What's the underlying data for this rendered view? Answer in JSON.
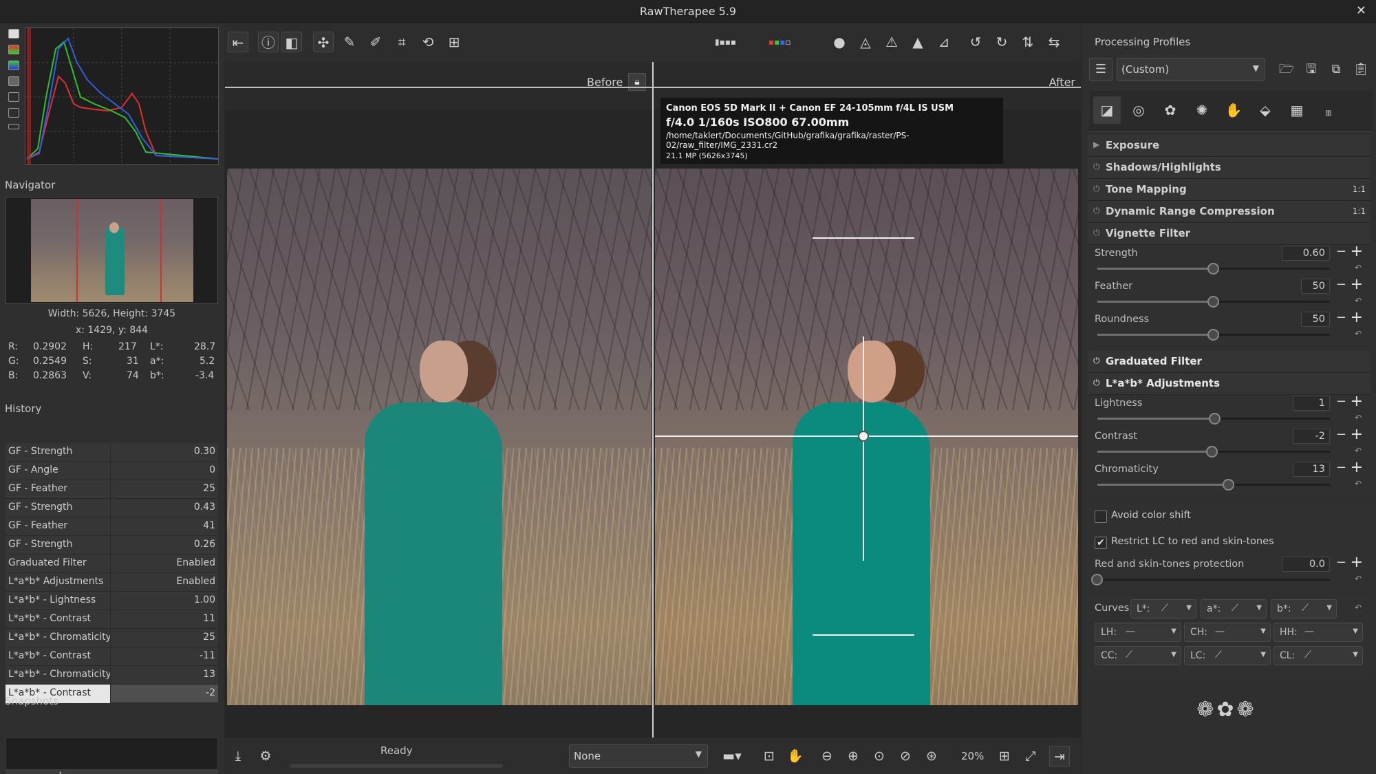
{
  "window": {
    "title": "RawTherapee 5.9"
  },
  "left": {
    "navigator_label": "Navigator",
    "size_text": "Width: 5626, Height: 3745",
    "coords_text": "x: 1429, y: 844",
    "readout": {
      "r_label": "R:",
      "r_val": "0.2902",
      "h_label": "H:",
      "h_val": "217",
      "l_label": "L*:",
      "l_val": "28.7",
      "g_label": "G:",
      "g_val": "0.2549",
      "s_label": "S:",
      "s_val": "31",
      "a_label": "a*:",
      "a_val": "5.2",
      "b_label": "B:",
      "b_val": "0.2863",
      "v_label": "V:",
      "v_val": "74",
      "bs_label": "b*:",
      "bs_val": "-3.4"
    },
    "history_label": "History",
    "history": [
      {
        "name": "GF - Strength",
        "value": "0.30"
      },
      {
        "name": "GF - Angle",
        "value": "0"
      },
      {
        "name": "GF - Feather",
        "value": "25"
      },
      {
        "name": "GF - Strength",
        "value": "0.43"
      },
      {
        "name": "GF - Feather",
        "value": "41"
      },
      {
        "name": "GF - Strength",
        "value": "0.26"
      },
      {
        "name": "Graduated Filter",
        "value": "Enabled"
      },
      {
        "name": "L*a*b* Adjustments",
        "value": "Enabled"
      },
      {
        "name": "L*a*b* - Lightness",
        "value": "1.00"
      },
      {
        "name": "L*a*b* - Contrast",
        "value": "11"
      },
      {
        "name": "L*a*b* - Chromaticity",
        "value": "25"
      },
      {
        "name": "L*a*b* - Contrast",
        "value": "-11"
      },
      {
        "name": "L*a*b* - Chromaticity",
        "value": "13"
      },
      {
        "name": "L*a*b* - Contrast",
        "value": "-2"
      }
    ],
    "snapshots_label": "Snapshots",
    "snap_add": "+",
    "snap_remove": "−"
  },
  "center": {
    "before_label": "Before",
    "after_label": "After",
    "exif": {
      "camera": "Canon EOS 5D Mark II + Canon EF 24-105mm f/4L IS USM",
      "settings": "f/4.0  1/160s  ISO800  67.00mm",
      "path": "/home/taklert/Documents/GitHub/grafika/grafika/raster/PS-02/raw_filter/IMG_2331.cr2",
      "mp": "21.1 MP (5626x3745)"
    },
    "status": "Ready",
    "output_profile": "None",
    "zoom": "20%"
  },
  "right": {
    "profiles_label": "Processing Profiles",
    "profile_value": "(Custom)",
    "tools": {
      "exposure": "Exposure",
      "shadows": "Shadows/Highlights",
      "tone": "Tone Mapping",
      "drc": "Dynamic Range Compression",
      "vignette": "Vignette Filter",
      "graduated": "Graduated Filter",
      "lab": "L*a*b* Adjustments",
      "ratio": "1:1"
    },
    "vignette": {
      "strength_label": "Strength",
      "strength": "0.60",
      "strength_level": 0.5,
      "feather_label": "Feather",
      "feather": "50",
      "feather_level": 0.5,
      "roundness_label": "Roundness",
      "roundness": "50",
      "roundness_level": 0.5
    },
    "lab": {
      "lightness_label": "Lightness",
      "lightness": "1",
      "lightness_level": 0.505,
      "contrast_label": "Contrast",
      "contrast": "-2",
      "contrast_level": 0.495,
      "chroma_label": "Chromaticity",
      "chroma": "13",
      "chroma_level": 0.565,
      "avoid_shift": "Avoid color shift",
      "restrict": "Restrict LC to red and skin-tones",
      "protection_label": "Red and skin-tones protection",
      "protection": "0.0",
      "protection_level": 0.0,
      "curves_label": "Curves:",
      "curves": [
        "L*:",
        "a*:",
        "b*:",
        "LH:",
        "CH:",
        "HH:",
        "CC:",
        "LC:",
        "CL:"
      ]
    }
  },
  "colors": {
    "accent": "#1b877b",
    "selection": "#e6e6e6",
    "red_frame": "#d23030"
  }
}
